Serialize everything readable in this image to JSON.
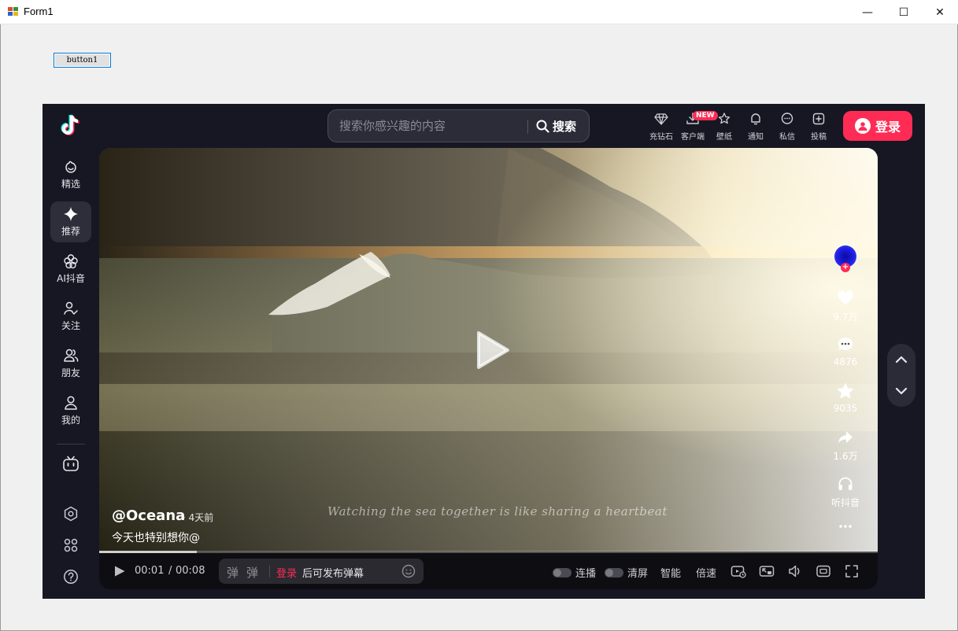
{
  "window": {
    "title": "Form1",
    "minimize_glyph": "—",
    "maximize_glyph": "☐",
    "close_glyph": "✕"
  },
  "form": {
    "button1_label": "button1"
  },
  "douyin": {
    "search": {
      "placeholder": "搜索你感兴趣的内容",
      "button_label": "搜索"
    },
    "top_actions": [
      {
        "label": "充钻石",
        "icon": "diamond-icon"
      },
      {
        "label": "客户端",
        "icon": "download-icon",
        "badge": "NEW"
      },
      {
        "label": "壁纸",
        "icon": "wallpaper-icon"
      },
      {
        "label": "通知",
        "icon": "bell-icon"
      },
      {
        "label": "私信",
        "icon": "message-icon"
      },
      {
        "label": "投稿",
        "icon": "upload-icon"
      }
    ],
    "login_label": "登录",
    "sidenav": [
      {
        "label": "精选",
        "icon": "featured-icon"
      },
      {
        "label": "推荐",
        "icon": "sparkle-icon",
        "active": true
      },
      {
        "label": "AI抖音",
        "icon": "ai-flower-icon"
      },
      {
        "label": "关注",
        "icon": "follow-icon"
      },
      {
        "label": "朋友",
        "icon": "friends-icon"
      },
      {
        "label": "我的",
        "icon": "profile-icon"
      }
    ],
    "sidenav_extra_icons": [
      "tv-icon",
      "settings-icon",
      "apps-grid-icon",
      "help-icon"
    ],
    "video": {
      "author": "@Oceana",
      "time": "· 4天前",
      "caption": "今天也特别想你@",
      "overlay_text": "Watching the sea together is like sharing a heartbeat",
      "progress": 0.125
    },
    "side_actions": {
      "likes": "9.7万",
      "comments": "4876",
      "favorites": "9035",
      "shares": "1.6万",
      "listen": "听抖音",
      "follow_plus": "+"
    },
    "controls": {
      "current_time": "00:01",
      "separator": "/",
      "duration": "00:08",
      "danmu_icon": "弹",
      "danmu_login": "登录",
      "danmu_hint": "后可发布弹幕",
      "autoplay_label": "连播",
      "clear_label": "清屏",
      "smart_label": "智能",
      "speed_label": "倍速"
    }
  }
}
